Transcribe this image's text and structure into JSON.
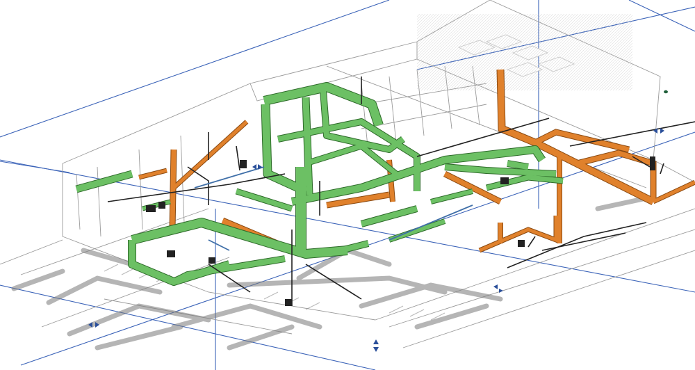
{
  "viewport": {
    "background": "#ffffff"
  },
  "colors": {
    "supply_duct": "#6cc064",
    "supply_duct_edge": "#2e6b2a",
    "exhaust_duct": "#e0812c",
    "exhaust_duct_edge": "#8a4a12",
    "building_outline": "#9a9a9a",
    "building_outline_light": "#c8c8c8",
    "shadow": "#7a7a7a",
    "section_box": "#3b63b8",
    "pipe_dark": "#222222",
    "pipe_blue": "#3f6fa8",
    "view_control": "#2a4f9a"
  },
  "icons": {
    "view_control": "section-box-grip-icon",
    "rotate": "orbit-arrows-icon"
  },
  "layers": [
    "section-box-lines",
    "building-shell",
    "shadows",
    "exhaust-ducts",
    "supply-ducts",
    "pipes"
  ]
}
